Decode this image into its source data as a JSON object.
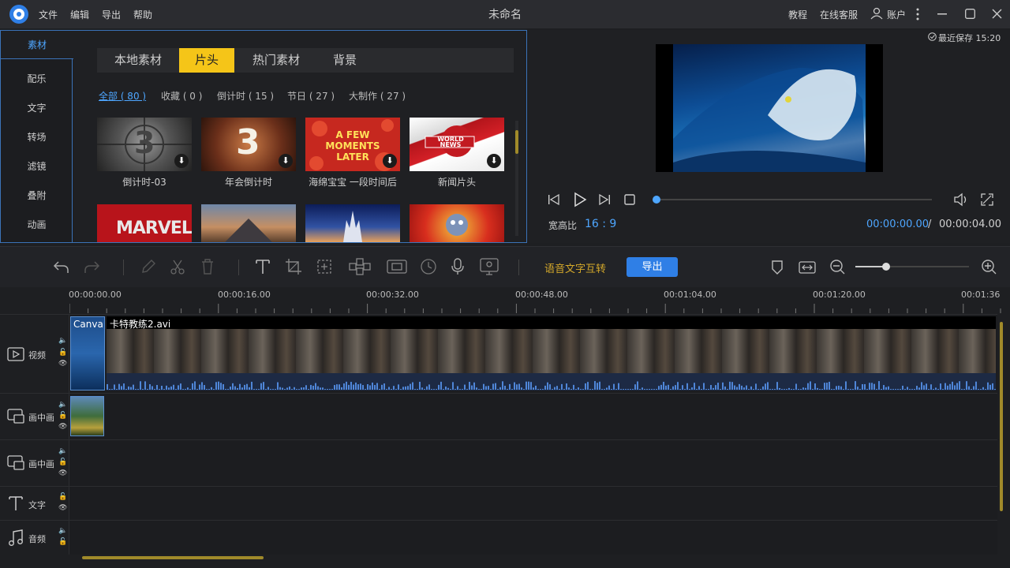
{
  "titlebar": {
    "menus": [
      "文件",
      "编辑",
      "导出",
      "帮助"
    ],
    "title": "未命名",
    "tutorial": "教程",
    "support": "在线客服",
    "account": "账户"
  },
  "sidebar": {
    "items": [
      "素材",
      "配乐",
      "文字",
      "转场",
      "滤镜",
      "叠附",
      "动画"
    ]
  },
  "library": {
    "tabs": [
      "本地素材",
      "片头",
      "热门素材",
      "背景"
    ],
    "categories": [
      "全部 ( 80 )",
      "收藏 ( 0 )",
      "倒计时 ( 15 )",
      "节日 ( 27 )",
      "大制作 ( 27 )"
    ],
    "items": [
      {
        "label": "倒计时-03",
        "overlay": "3"
      },
      {
        "label": "年会倒计时",
        "overlay": "3"
      },
      {
        "label": "海绵宝宝 一段时间后",
        "overlay": "A FEW MOMENTS LATER"
      },
      {
        "label": "新闻片头",
        "overlay": "WORLD NEWS"
      }
    ],
    "row2_overlays": [
      "MARVEL",
      "",
      "",
      ""
    ]
  },
  "preview": {
    "saved": "最近保存 15:20",
    "aspect_label": "宽高比",
    "aspect_value": "16 : 9",
    "time_current": "00:00:00.00",
    "time_sep": "/",
    "time_total": "00:00:04.00",
    "progress": 0
  },
  "toolbar": {
    "speech_text": "语音文字互转",
    "export": "导出"
  },
  "timeline": {
    "ruler": [
      "00:00:00.00",
      "00:00:16.00",
      "00:00:32.00",
      "00:00:48.00",
      "00:01:04.00",
      "00:01:20.00",
      "00:01:36"
    ],
    "tracks": [
      {
        "name": "视频"
      },
      {
        "name": "画中画"
      },
      {
        "name": "画中画"
      },
      {
        "name": "文字"
      },
      {
        "name": "音频"
      }
    ],
    "clip_canvas": "Canva",
    "clip_video": "卡特教练2.avi"
  },
  "colors": {
    "accent": "#2f7fe6",
    "active_tab": "#f5c518",
    "link": "#4ea6ff"
  }
}
